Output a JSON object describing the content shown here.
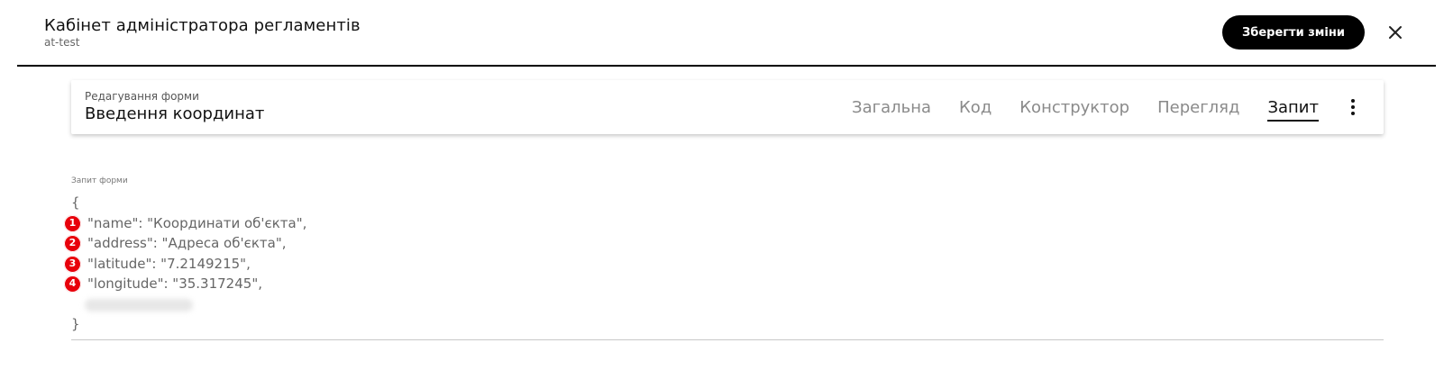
{
  "header": {
    "title": "Кабінет адміністратора регламентів",
    "subtitle": "at-test",
    "save_label": "Зберегти зміни",
    "close_icon": "close-icon"
  },
  "form": {
    "caption": "Редагування форми",
    "title": "Введення координат",
    "tabs": [
      {
        "label": "Загальна",
        "active": false
      },
      {
        "label": "Код",
        "active": false
      },
      {
        "label": "Конструктор",
        "active": false
      },
      {
        "label": "Перегляд",
        "active": false
      },
      {
        "label": "Запит",
        "active": true
      }
    ],
    "more_icon": "more-vertical-icon"
  },
  "request": {
    "label": "Запит форми",
    "open_brace": "{",
    "close_brace": "}",
    "lines": [
      {
        "badge": "1",
        "text": "\"name\": \"Координати об'єкта\","
      },
      {
        "badge": "2",
        "text": "\"address\": \"Адреса об'єкта\","
      },
      {
        "badge": "3",
        "text": "\"latitude\": \"7.2149215\","
      },
      {
        "badge": "4",
        "text": "\"longitude\": \"35.317245\","
      }
    ]
  },
  "colors": {
    "accent": "#000000",
    "badge": "#e8000b",
    "muted_text": "#8a8a8a"
  }
}
